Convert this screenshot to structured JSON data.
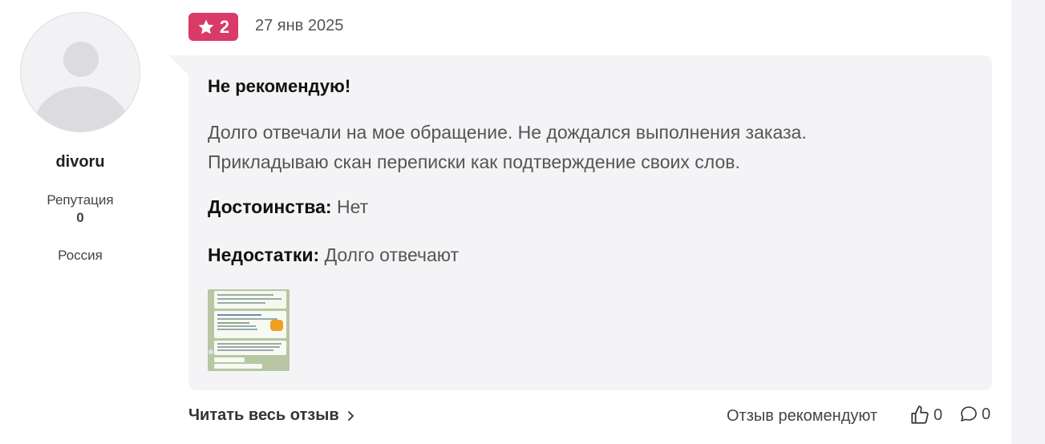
{
  "author": {
    "name": "divoru",
    "reputation_label": "Репутация",
    "reputation_value": "0",
    "country": "Россия"
  },
  "review": {
    "rating": "2",
    "date": "27 янв 2025",
    "title": "Не рекомендую!",
    "text": "Долго отвечали на мое обращение. Не дождался выполнения заказа. Прикладываю скан переписки как подтверждение своих слов.",
    "pros_label": "Достоинства:",
    "pros_value": "Нет",
    "cons_label": "Недостатки:",
    "cons_value": "Долго отвечают"
  },
  "footer": {
    "read_full_label": "Читать весь отзыв",
    "recommend_label": "Отзыв рекомендуют",
    "likes_count": "0",
    "comments_count": "0"
  },
  "colors": {
    "rating_badge": "#d93a68",
    "card_background": "#f4f4f6",
    "avatar_background": "#f2f2f4"
  },
  "icons": {
    "rating": "star-icon",
    "read_full": "chevron-right-icon",
    "likes": "thumbs-up-icon",
    "comments": "comment-icon"
  }
}
